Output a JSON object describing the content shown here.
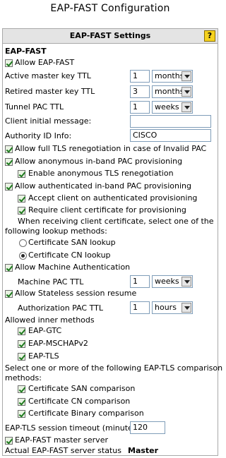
{
  "page_title": "EAP-FAST Configuration",
  "panel": {
    "header": "EAP-FAST Settings",
    "help_icon": "?"
  },
  "section_label": "EAP-FAST",
  "allow_eap_fast": "Allow EAP-FAST",
  "active_master_key_ttl": {
    "label": "Active master key TTL",
    "value": "1",
    "unit": "months"
  },
  "retired_master_key_ttl": {
    "label": "Retired master key TTL",
    "value": "3",
    "unit": "months"
  },
  "tunnel_pac_ttl": {
    "label": "Tunnel PAC TTL",
    "value": "1",
    "unit": "weeks"
  },
  "client_initial_message": {
    "label": "Client initial message:",
    "value": ""
  },
  "authority_id_info": {
    "label": "Authority ID Info:",
    "value": "CISCO"
  },
  "allow_full_tls_renegotiation": "Allow full TLS renegotiation in case of Invalid PAC",
  "allow_anonymous_inband": "Allow anonymous in-band PAC provisioning",
  "enable_anonymous_tls_reneg": "Enable anonymous TLS renegotiation",
  "allow_authenticated_inband": "Allow authenticated in-band PAC provisioning",
  "accept_client_authenticated": "Accept client on authenticated provisioning",
  "require_client_cert": "Require client certificate for provisioning",
  "lookup_text_1": "When receiving client certificate, select one of the",
  "lookup_text_2": "following lookup methods:",
  "cert_san_lookup": "Certificate SAN lookup",
  "cert_cn_lookup": "Certificate CN lookup",
  "allow_machine_auth": "Allow Machine Authentication",
  "machine_pac_ttl": {
    "label": "Machine PAC TTL",
    "value": "1",
    "unit": "weeks"
  },
  "allow_stateless_resume": "Allow Stateless session resume",
  "authorization_pac_ttl": {
    "label": "Authorization PAC TTL",
    "value": "1",
    "unit": "hours"
  },
  "allowed_inner_methods": "Allowed inner methods",
  "inner_methods": [
    "EAP-GTC",
    "EAP-MSCHAPv2",
    "EAP-TLS"
  ],
  "comparison_text_1": "Select one or more of the following EAP-TLS comparison",
  "comparison_text_2": "methods:",
  "comparisons": [
    "Certificate SAN comparison",
    "Certificate CN comparison",
    "Certificate Binary comparison"
  ],
  "session_timeout": {
    "label": "EAP-TLS session timeout (minutes)",
    "value": "120"
  },
  "master_server": "EAP-FAST master server",
  "actual_status": {
    "label": "Actual EAP-FAST server status",
    "value": "Master"
  }
}
